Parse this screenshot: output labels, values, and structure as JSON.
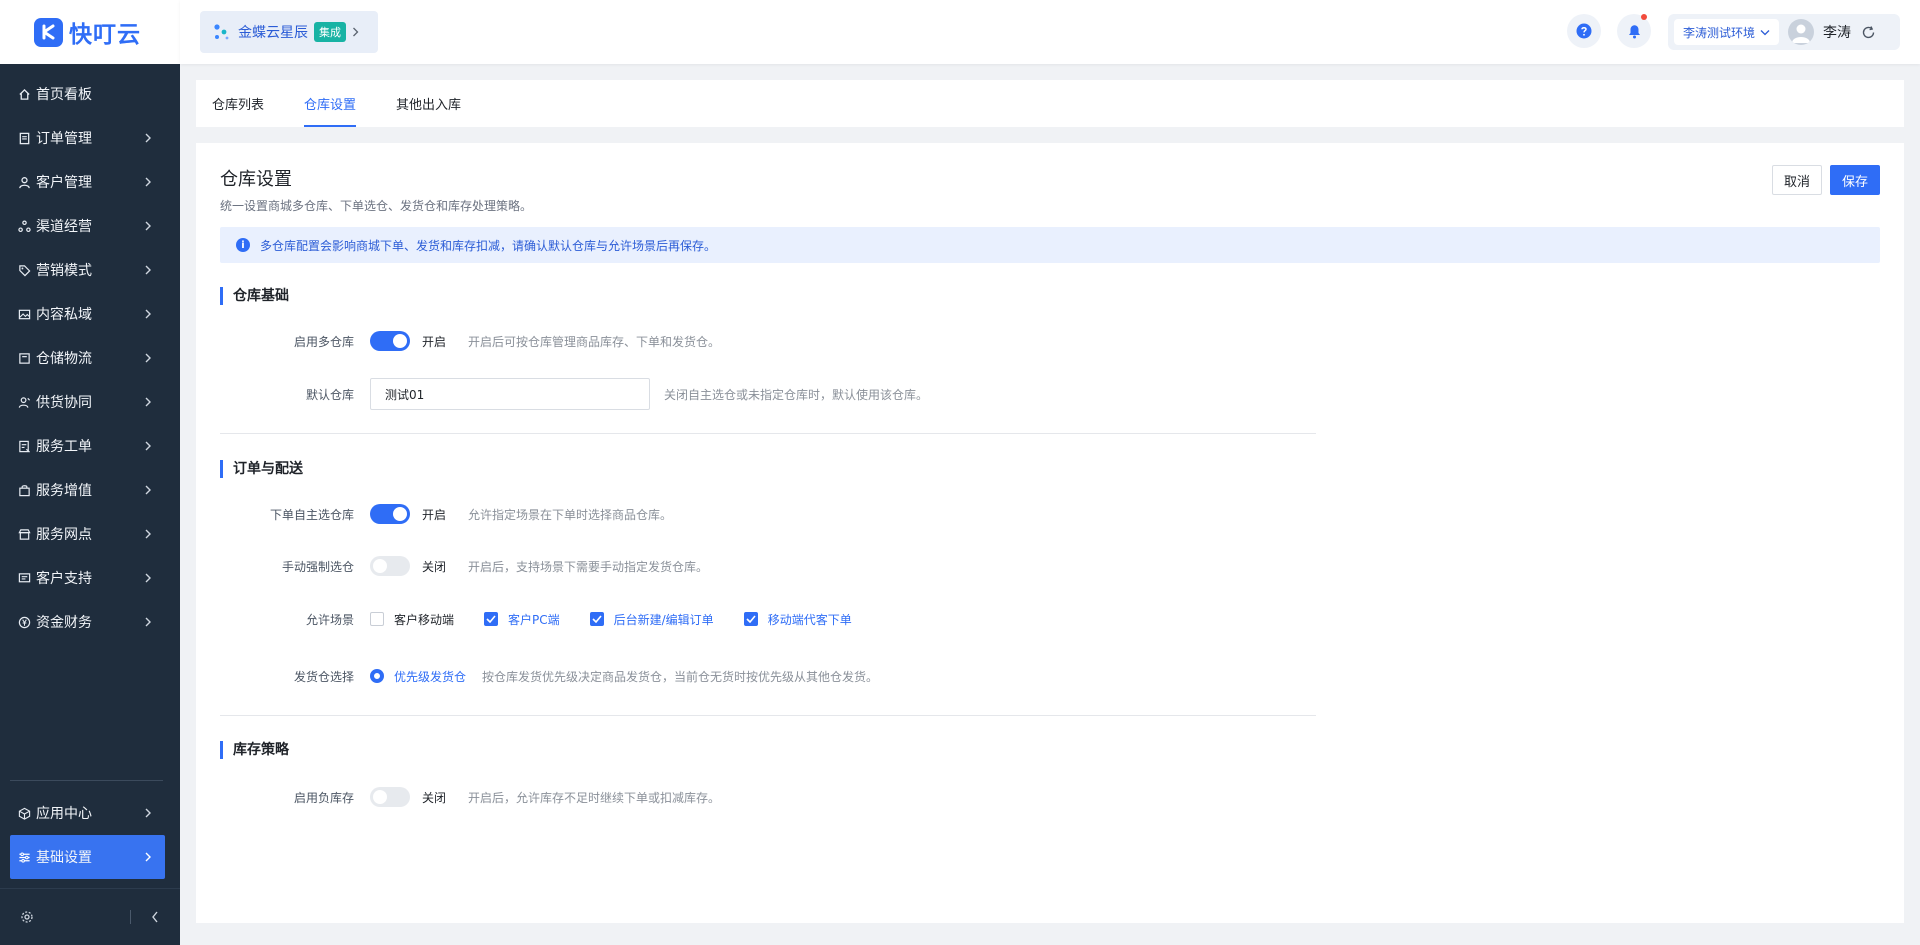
{
  "app": {
    "logo_text": "快叮云"
  },
  "sidebar": {
    "items": [
      {
        "label": "首页看板",
        "icon": "home-icon",
        "has_children": false
      },
      {
        "label": "订单管理",
        "icon": "order-icon",
        "has_children": true
      },
      {
        "label": "客户管理",
        "icon": "user-icon",
        "has_children": true
      },
      {
        "label": "渠道经营",
        "icon": "channel-icon",
        "has_children": true
      },
      {
        "label": "营销模式",
        "icon": "tag-icon",
        "has_children": true
      },
      {
        "label": "内容私域",
        "icon": "image-icon",
        "has_children": true
      },
      {
        "label": "仓储物流",
        "icon": "warehouse-icon",
        "has_children": true
      },
      {
        "label": "供货协同",
        "icon": "supplier-icon",
        "has_children": true
      },
      {
        "label": "服务工单",
        "icon": "ticket-icon",
        "has_children": true
      },
      {
        "label": "服务增值",
        "icon": "bag-icon",
        "has_children": true
      },
      {
        "label": "服务网点",
        "icon": "store-icon",
        "has_children": true
      },
      {
        "label": "客户支持",
        "icon": "support-icon",
        "has_children": true
      },
      {
        "label": "资金财务",
        "icon": "finance-icon",
        "has_children": true
      }
    ],
    "bottom_items": [
      {
        "label": "应用中心",
        "icon": "cube-icon",
        "active": false
      },
      {
        "label": "基础设置",
        "icon": "settings-sliders-icon",
        "active": true
      }
    ]
  },
  "header": {
    "tenant_name": "金蝶云星辰",
    "tenant_tag": "集成",
    "environment": "李涛测试环境",
    "user_name": "李涛",
    "accent_color": "#2f6df6"
  },
  "tabs": [
    {
      "label": "仓库列表",
      "active": false
    },
    {
      "label": "仓库设置",
      "active": true
    },
    {
      "label": "其他出入库",
      "active": false
    }
  ],
  "page": {
    "title": "仓库设置",
    "description": "统一设置商城多仓库、下单选仓、发货仓和库存处理策略。",
    "cancel_label": "取消",
    "save_label": "保存",
    "alert": "多仓库配置会影响商城下单、发货和库存扣减，请确认默认仓库与允许场景后再保存。"
  },
  "sections": {
    "basic": {
      "title": "仓库基础",
      "multi_warehouse": {
        "label": "启用多仓库",
        "state": "开启",
        "enabled": true,
        "hint": "开启后可按仓库管理商品库存、下单和发货仓。"
      },
      "default_warehouse": {
        "label": "默认仓库",
        "value": "测试01",
        "hint": "关闭自主选仓或未指定仓库时，默认使用该仓库。"
      }
    },
    "order": {
      "title": "订单与配送",
      "self_select": {
        "label": "下单自主选仓库",
        "state": "开启",
        "enabled": true,
        "hint": "允许指定场景在下单时选择商品仓库。"
      },
      "force_select": {
        "label": "手动强制选仓",
        "state": "关闭",
        "enabled": false,
        "hint": "开启后，支持场景下需要手动指定发货仓库。"
      },
      "scenes": {
        "label": "允许场景",
        "options": [
          {
            "label": "客户移动端",
            "checked": false
          },
          {
            "label": "客户PC端",
            "checked": true
          },
          {
            "label": "后台新建/编辑订单",
            "checked": true
          },
          {
            "label": "移动端代客下单",
            "checked": true
          }
        ]
      },
      "ship_select": {
        "label": "发货仓选择",
        "option": "优先级发货仓",
        "hint": "按仓库发货优先级决定商品发货仓，当前仓无货时按优先级从其他仓发货。"
      }
    },
    "stock": {
      "title": "库存策略",
      "negative": {
        "label": "启用负库存",
        "state": "关闭",
        "enabled": false,
        "hint": "开启后，允许库存不足时继续下单或扣减库存。"
      }
    }
  }
}
